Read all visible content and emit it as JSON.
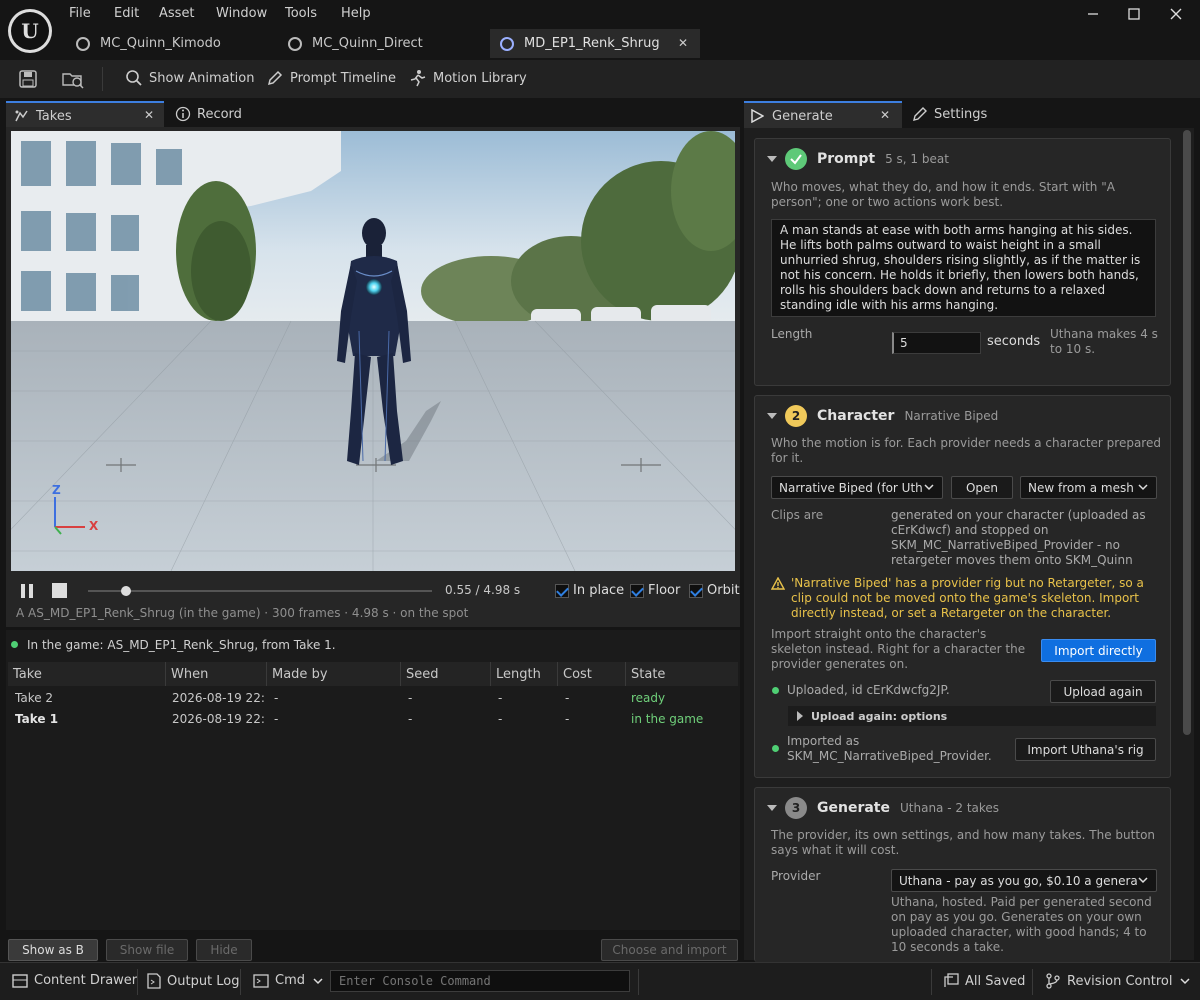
{
  "menu": [
    "File",
    "Edit",
    "Asset",
    "Window",
    "Tools",
    "Help"
  ],
  "doc_tabs": [
    {
      "label": "MC_Quinn_Kimodo"
    },
    {
      "label": "MC_Quinn_Direct"
    },
    {
      "label": "MD_EP1_Renk_Shrug"
    }
  ],
  "toolbar": {
    "show_animation": "Show Animation",
    "prompt_timeline": "Prompt Timeline",
    "motion_library": "Motion Library"
  },
  "left_tabs": {
    "takes": "Takes",
    "record": "Record"
  },
  "viewport": {
    "axis_z": "Z",
    "axis_x": "X",
    "time": "0.55 / 4.98 s",
    "playhead_fraction": 0.11,
    "in_place": "In place",
    "floor": "Floor",
    "orbit": "Orbit",
    "info": "A  AS_MD_EP1_Renk_Shrug (in the game) · 300 frames · 4.98 s · on the spot"
  },
  "takes": {
    "status": "In the game: AS_MD_EP1_Renk_Shrug, from Take 1.",
    "columns": [
      "Take",
      "When",
      "Made by",
      "Seed",
      "Length",
      "Cost",
      "State"
    ],
    "rows": [
      {
        "take": "Take 2",
        "when": "2026-08-19 22:",
        "made_by": "-",
        "seed": "-",
        "length": "-",
        "cost": "-",
        "state": "ready"
      },
      {
        "take": "Take 1",
        "when": "2026-08-19 22:",
        "made_by": "-",
        "seed": "-",
        "length": "-",
        "cost": "-",
        "state": "in the game"
      }
    ],
    "show_as_b": "Show as B",
    "show_file": "Show file",
    "hide": "Hide",
    "choose_import": "Choose and import"
  },
  "right_tabs": {
    "generate": "Generate",
    "settings": "Settings"
  },
  "prompt": {
    "title": "Prompt",
    "sub": "5 s, 1 beat",
    "help": "Who moves, what they do, and how it ends. Start with \"A person\"; one or two actions work best.",
    "text": "A man stands at ease with both arms hanging at his sides. He lifts both palms outward to waist height in a small unhurried shrug, shoulders rising slightly, as if the matter is not his concern. He holds it briefly, then lowers both hands, rolls his shoulders back down and returns to a relaxed standing idle with his arms hanging.",
    "length_label": "Length",
    "length_value": "5",
    "seconds": "seconds",
    "length_note": "Uthana makes 4 s to 10 s."
  },
  "character": {
    "badge": "2",
    "title": "Character",
    "sub": "Narrative Biped",
    "help": "Who the motion is for. Each provider needs a character prepared for it.",
    "select": "Narrative Biped  (for Uth",
    "open": "Open",
    "new_from_mesh": "New from a mesh",
    "clips_label": "Clips are",
    "clips_text": "generated on your character (uploaded as cErKdwcf) and stopped on SKM_MC_NarrativeBiped_Provider - no retargeter moves them onto SKM_Quinn",
    "warning": "'Narrative Biped' has a provider rig but no Retargeter, so a clip could not be moved onto the game's skeleton. Import directly instead, or set a Retargeter on the character.",
    "import_help": "Import straight onto the character's skeleton instead. Right for a character the provider generates on.",
    "import_directly": "Import directly",
    "uploaded": "Uploaded, id cErKdwcfg2JP.",
    "upload_again": "Upload again",
    "upload_options": "Upload again: options",
    "imported": "Imported as SKM_MC_NarrativeBiped_Provider.",
    "import_rig": "Import Uthana's rig"
  },
  "generate": {
    "badge": "3",
    "title": "Generate",
    "sub": "Uthana  -  2 takes",
    "help": "The provider, its own settings, and how many takes. The button says what it will cost.",
    "provider_label": "Provider",
    "provider_value": "Uthana  -  pay as you go, $0.10 a genera",
    "provider_help": "Uthana, hosted. Paid per generated second on pay as you go. Generates on your own uploaded character, with good hands; 4 to 10 seconds a take."
  },
  "statusbar": {
    "content_drawer": "Content Drawer",
    "output_log": "Output Log",
    "cmd": "Cmd",
    "console_placeholder": "Enter Console Command",
    "all_saved": "All Saved",
    "revision_control": "Revision Control"
  },
  "colors": {
    "accent_blue": "#0f6fe0",
    "ready_green": "#4fcf74",
    "warning_yellow": "#e8c24a",
    "success_green": "#5ec978"
  }
}
